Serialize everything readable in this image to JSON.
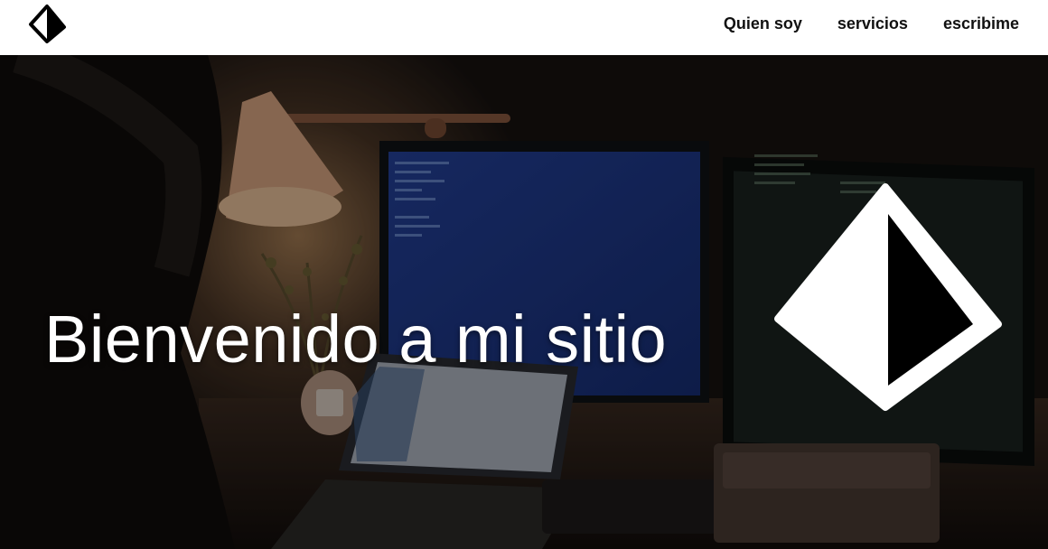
{
  "nav": {
    "items": [
      {
        "label": "Quien soy"
      },
      {
        "label": "servicios"
      },
      {
        "label": "escribime"
      }
    ]
  },
  "hero": {
    "title": "Bienvenido a mi sitio"
  },
  "icons": {
    "logo": "prism-logo-icon",
    "emblem": "prism-emblem-icon"
  },
  "colors": {
    "navbar_bg": "#ffffff",
    "nav_text": "#111111",
    "hero_text": "#ffffff",
    "screen_blue": "#1f3a8c"
  }
}
